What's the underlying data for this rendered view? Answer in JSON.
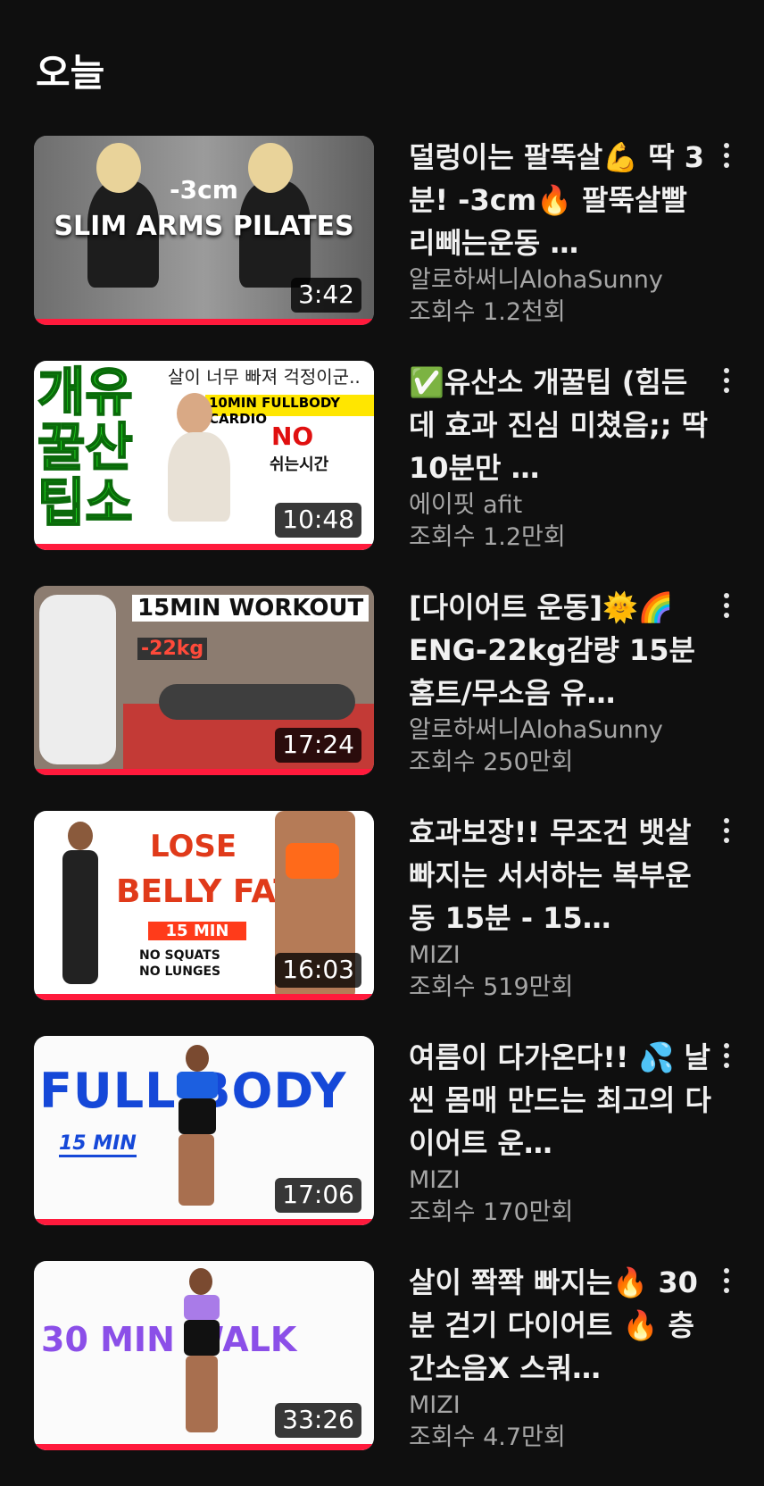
{
  "section": {
    "title": "오늘"
  },
  "videos": [
    {
      "title": "덜렁이는 팔뚝살💪 딱 3분! -3cm🔥 팔뚝살빨리빼는운동 …",
      "channel": "알로하써니AlohaSunny",
      "views": "조회수 1.2천회",
      "duration": "3:42",
      "thumb_text": [
        "-3cm",
        "SLIM ARMS PILATES"
      ],
      "watched_fraction": 1.0
    },
    {
      "title": "✅유산소 개꿀팁 (힘든데 효과 진심 미쳤음;; 딱 10분만 …",
      "channel": "에이핏 afit",
      "views": "조회수 1.2만회",
      "duration": "10:48",
      "thumb_text": [
        "개유꿀산팁소",
        "살이 너무 빠져 걱정이군..",
        "10MIN FULLBODY CARDIO",
        "NO",
        "쉬는시간"
      ],
      "watched_fraction": 1.0
    },
    {
      "title": "[다이어트 운동]🌞🌈ENG-22kg감량 15분홈트/무소음 유…",
      "channel": "알로하써니AlohaSunny",
      "views": "조회수 250만회",
      "duration": "17:24",
      "thumb_text": [
        "15MIN WORKOUT",
        "-22kg"
      ],
      "watched_fraction": 1.0
    },
    {
      "title": "효과보장!! 무조건 뱃살 빠지는 서서하는 복부운동 15분 - 15…",
      "channel": "MIZI",
      "views": "조회수 519만회",
      "duration": "16:03",
      "thumb_text": [
        "LOSE",
        "BELLY FAT",
        "15 MIN",
        "NO SQUATS",
        "NO LUNGES"
      ],
      "watched_fraction": 1.0
    },
    {
      "title": "여름이 다가온다!! 💦 날씬 몸매 만드는 최고의 다이어트 운…",
      "channel": "MIZI",
      "views": "조회수 170만회",
      "duration": "17:06",
      "thumb_text": [
        "FULL BODY",
        "15 MIN"
      ],
      "watched_fraction": 1.0
    },
    {
      "title": "살이 쫙쫙 빠지는🔥 30분 걷기 다이어트 🔥 층간소음X 스쿼…",
      "channel": "MIZI",
      "views": "조회수 4.7만회",
      "duration": "33:26",
      "thumb_text": [
        "30 MIN WALK"
      ],
      "watched_fraction": 1.0
    }
  ],
  "icons": {
    "more": "more-vert-icon"
  },
  "colors": {
    "background": "#0f0f0f",
    "progress": "#ff1a3c",
    "secondary_text": "#a6a6a6"
  }
}
